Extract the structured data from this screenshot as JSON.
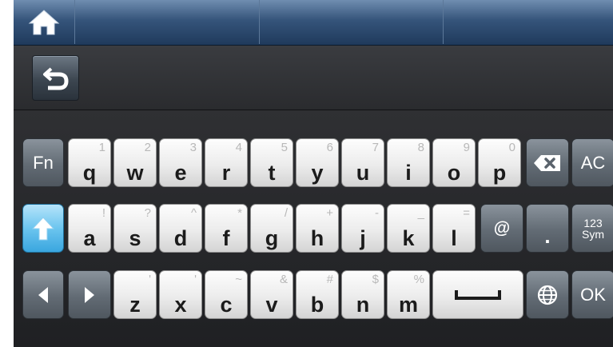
{
  "topbar": {
    "home_icon": "home-icon"
  },
  "subbar": {
    "back_icon": "return-arrow-icon"
  },
  "keyboard": {
    "row1": [
      {
        "main": "q",
        "sub": "1"
      },
      {
        "main": "w",
        "sub": "2"
      },
      {
        "main": "e",
        "sub": "3"
      },
      {
        "main": "r",
        "sub": "4"
      },
      {
        "main": "t",
        "sub": "5"
      },
      {
        "main": "y",
        "sub": "6"
      },
      {
        "main": "u",
        "sub": "7"
      },
      {
        "main": "i",
        "sub": "8"
      },
      {
        "main": "o",
        "sub": "9"
      },
      {
        "main": "p",
        "sub": "0"
      }
    ],
    "row2": [
      {
        "main": "a",
        "sub": "!"
      },
      {
        "main": "s",
        "sub": "?"
      },
      {
        "main": "d",
        "sub": "^"
      },
      {
        "main": "f",
        "sub": "*"
      },
      {
        "main": "g",
        "sub": "/"
      },
      {
        "main": "h",
        "sub": "+"
      },
      {
        "main": "j",
        "sub": "-"
      },
      {
        "main": "k",
        "sub": "_"
      },
      {
        "main": "l",
        "sub": "="
      }
    ],
    "row3": [
      {
        "main": "z",
        "sub": "'"
      },
      {
        "main": "x",
        "sub": "'"
      },
      {
        "main": "c",
        "sub": "~"
      },
      {
        "main": "v",
        "sub": "&"
      },
      {
        "main": "b",
        "sub": "#"
      },
      {
        "main": "n",
        "sub": "$"
      },
      {
        "main": "m",
        "sub": "%"
      }
    ],
    "fn_label": "Fn",
    "ac_label": "AC",
    "ok_label": "OK",
    "at_label": "@",
    "dot_label": ".",
    "sym_label_top": "123",
    "sym_label_bottom": "Sym",
    "icons": {
      "backspace": "backspace-icon",
      "shift": "shift-arrow-icon",
      "left": "left-arrow-icon",
      "right": "right-arrow-icon",
      "space": "space-bar-icon",
      "language": "globe-icon"
    },
    "colors": {
      "shift_accent": "#3aa6df",
      "topbar": "#35547a"
    }
  }
}
